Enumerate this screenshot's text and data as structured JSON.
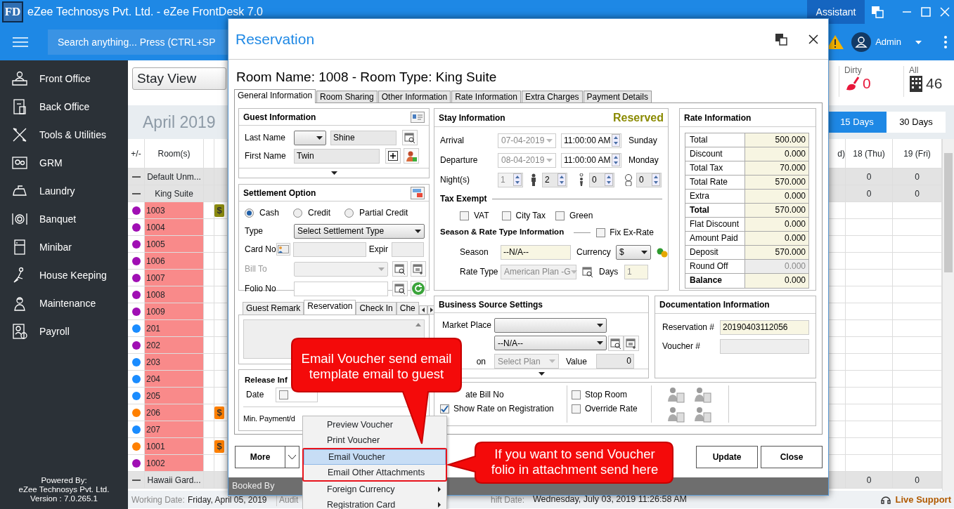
{
  "app": {
    "logo": "FD",
    "title": "eZee Technosys Pvt. Ltd. - eZee FrontDesk 7.0",
    "assistant": "Assistant"
  },
  "toolbar": {
    "search_placeholder": "Search anything... Press (CTRL+SP",
    "user": "Admin"
  },
  "sidebar": {
    "items": [
      {
        "label": "Front Office"
      },
      {
        "label": "Back Office"
      },
      {
        "label": "Tools & Utilities"
      },
      {
        "label": "GRM"
      },
      {
        "label": "Laundry"
      },
      {
        "label": "Banquet"
      },
      {
        "label": "Minibar"
      },
      {
        "label": "House Keeping"
      },
      {
        "label": "Maintenance"
      },
      {
        "label": "Payroll"
      }
    ],
    "footer": [
      "Powered By:",
      "eZee Technosys Pvt. Ltd.",
      "Version : 7.0.265.1"
    ]
  },
  "view": {
    "selector": "Stay View",
    "month": "April 2019",
    "stats": [
      {
        "kind": "dirty",
        "label": "Dirty",
        "value": "0"
      },
      {
        "kind": "all",
        "label": "All",
        "value": "46"
      }
    ],
    "ranges": [
      {
        "label": "15 Days",
        "selected": true
      },
      {
        "label": "30 Days",
        "selected": false
      }
    ]
  },
  "grid": {
    "columns_left": [
      "+/-",
      "Room(s)"
    ],
    "columns_right": [
      "d)",
      "18 (Thu)",
      "19 (Fri)"
    ],
    "rows": [
      {
        "kind": "group",
        "room": "Default Unm...",
        "values": [
          "0",
          "0"
        ]
      },
      {
        "kind": "group",
        "room": "King Suite",
        "values": [
          "0",
          "0"
        ]
      },
      {
        "kind": "room",
        "room": "1003",
        "color": "#a00fb4",
        "badge": {
          "text": "$",
          "color": "#8a8a10"
        }
      },
      {
        "kind": "room",
        "room": "1004",
        "color": "#a00fb4"
      },
      {
        "kind": "room",
        "room": "1005",
        "color": "#a00fb4"
      },
      {
        "kind": "room",
        "room": "1006",
        "color": "#a00fb4"
      },
      {
        "kind": "room",
        "room": "1007",
        "color": "#a00fb4"
      },
      {
        "kind": "room",
        "room": "1008",
        "color": "#a00fb4"
      },
      {
        "kind": "room",
        "room": "1009",
        "color": "#a00fb4"
      },
      {
        "kind": "room",
        "room": "201",
        "color": "#1a8cff"
      },
      {
        "kind": "room",
        "room": "202",
        "color": "#a00fb4"
      },
      {
        "kind": "room",
        "room": "203",
        "color": "#1a8cff"
      },
      {
        "kind": "room",
        "room": "204",
        "color": "#1a8cff"
      },
      {
        "kind": "room",
        "room": "205",
        "color": "#1a8cff"
      },
      {
        "kind": "room",
        "room": "206",
        "color": "#ff8000",
        "badge": {
          "text": "$",
          "color": "#ff8000"
        }
      },
      {
        "kind": "room",
        "room": "207",
        "color": "#1a8cff"
      },
      {
        "kind": "room",
        "room": "1001",
        "color": "#ff8000",
        "badge": {
          "text": "$",
          "color": "#ff8000"
        }
      },
      {
        "kind": "room",
        "room": "1002",
        "color": "#a00fb4"
      },
      {
        "kind": "group",
        "room": "Hawaii Gard...",
        "values": [
          "0",
          "0"
        ]
      }
    ]
  },
  "dialog": {
    "title": "Reservation",
    "heading": "Room Name: 1008 - Room Type: King Suite",
    "tabs": [
      {
        "label": "General Information",
        "selected": true
      },
      {
        "label": "Room Sharing",
        "selected": false
      },
      {
        "label": "Other Information",
        "selected": false
      },
      {
        "label": "Rate Information",
        "selected": false
      },
      {
        "label": "Extra Charges",
        "selected": false
      },
      {
        "label": "Payment Details",
        "selected": false
      }
    ],
    "guest": {
      "title": "Guest Information",
      "last_name": {
        "label": "Last Name",
        "value": "Shine"
      },
      "first_name": {
        "label": "First Name",
        "value": "Twin"
      }
    },
    "settlement": {
      "title": "Settlement Option",
      "modes": [
        {
          "label": "Cash",
          "selected": true
        },
        {
          "label": "Credit",
          "selected": false
        },
        {
          "label": "Partial Credit",
          "selected": false
        }
      ],
      "type": {
        "label": "Type",
        "value": "Select Settlement Type"
      },
      "card_no": {
        "label": "Card No"
      },
      "expiry": {
        "label": "Expir"
      },
      "bill_to": {
        "label": "Bill To",
        "disabled": true
      },
      "folio_no": {
        "label": "Folio No"
      }
    },
    "remark_tabs": [
      {
        "label": "Guest Remark",
        "selected": false
      },
      {
        "label": "Reservation",
        "selected": true
      },
      {
        "label": "Check In",
        "selected": false
      },
      {
        "label": "Che",
        "selected": false
      }
    ],
    "release": {
      "title": "Release Inf",
      "date": {
        "label": "Date",
        "checked": false
      },
      "min_payment": {
        "label": "Min. Payment/d"
      }
    },
    "stay": {
      "title": "Stay Information",
      "status": "Reserved",
      "rows": [
        {
          "label": "Arrival",
          "date": "07-04-2019",
          "time": "11:00:00 AM",
          "day": "Sunday"
        },
        {
          "label": "Departure",
          "date": "08-04-2019",
          "time": "11:00:00 AM",
          "day": "Monday"
        }
      ],
      "nights": {
        "label": "Night(s)",
        "value": "1",
        "disabled": true
      },
      "occupancy": [
        {
          "kind": "adult",
          "value": "2"
        },
        {
          "kind": "child",
          "value": "0"
        },
        {
          "kind": "infant",
          "value": "0"
        }
      ],
      "tax_exempt": {
        "title": "Tax Exempt",
        "options": [
          {
            "label": "VAT",
            "checked": false
          },
          {
            "label": "City Tax",
            "checked": false
          },
          {
            "label": "Green",
            "checked": false
          }
        ]
      },
      "season_title": "Season & Rate Type Information",
      "fix_ex_rate": {
        "label": "Fix Ex-Rate",
        "checked": false
      },
      "season": {
        "label": "Season",
        "value": "--N/A--"
      },
      "currency": {
        "label": "Currency",
        "value": "$"
      },
      "rate_type": {
        "label": "Rate Type",
        "value": "American Plan -G"
      },
      "days": {
        "label": "Days",
        "value": "1",
        "disabled": true
      }
    },
    "rate": {
      "title": "Rate Information",
      "rows": [
        {
          "label": "Total",
          "value": "500.000",
          "bold": false,
          "disabled": false
        },
        {
          "label": "Discount",
          "value": "0.000",
          "bold": false,
          "disabled": false
        },
        {
          "label": "Total Tax",
          "value": "70.000",
          "bold": false,
          "disabled": false
        },
        {
          "label": "Total Rate",
          "value": "570.000",
          "bold": false,
          "disabled": false
        },
        {
          "label": "Extra",
          "value": "0.000",
          "bold": false,
          "disabled": false
        },
        {
          "label": "Total",
          "value": "570.000",
          "bold": true,
          "disabled": false
        },
        {
          "label": "Flat Discount",
          "value": "0.000",
          "bold": false,
          "disabled": false
        },
        {
          "label": "Amount Paid",
          "value": "0.000",
          "bold": false,
          "disabled": false
        },
        {
          "label": "Deposit",
          "value": "570.000",
          "bold": false,
          "disabled": false
        },
        {
          "label": "Round Off",
          "value": "0.000",
          "bold": false,
          "disabled": true
        },
        {
          "label": "Balance",
          "value": "0.000",
          "bold": true,
          "disabled": false
        }
      ]
    },
    "business": {
      "title": "Business Source Settings",
      "market_place": {
        "label": "Market Place"
      },
      "source": {
        "value": "--N/A--"
      },
      "plan": {
        "label": "on",
        "value": "Select Plan"
      },
      "amount": {
        "label": "Value",
        "value": "0"
      }
    },
    "documentation": {
      "title": "Documentation Information",
      "rows": [
        {
          "label": "Reservation #",
          "value": "20190403112056"
        },
        {
          "label": "Voucher #"
        }
      ]
    },
    "options": [
      [
        {
          "kind": "text",
          "label": "ate Bill No"
        },
        {
          "kind": "checkbox",
          "label": "Show Rate on Registration",
          "checked": true
        }
      ],
      [
        {
          "kind": "checkbox",
          "label": "Stop Room",
          "checked": false
        },
        {
          "kind": "checkbox",
          "label": "Override Rate",
          "checked": false
        }
      ]
    ],
    "footer": {
      "more": "More",
      "buttons": [
        "Update",
        "Close"
      ],
      "booked_by": "Booked By"
    }
  },
  "menu": {
    "items": [
      {
        "label": "Preview Voucher",
        "selected": false,
        "submenu": false
      },
      {
        "label": "Print Voucher",
        "selected": false,
        "submenu": false
      },
      {
        "label": "Email Voucher",
        "selected": true,
        "submenu": false
      },
      {
        "label": "Email Other Attachments",
        "selected": false,
        "submenu": false
      },
      {
        "label": "Foreign Currency",
        "selected": false,
        "submenu": true
      },
      {
        "label": "Registration Card",
        "selected": false,
        "submenu": true
      }
    ]
  },
  "callouts": [
    {
      "text": "Email Voucher send email template email to guest"
    },
    {
      "text": "If you want to send Voucher folio in attachment send here"
    }
  ],
  "status_bar": {
    "items": [
      {
        "label": "Working Date:",
        "value": "Friday, April 05, 2019"
      },
      {
        "label": "Audit"
      },
      {
        "label": "hift Date:",
        "value": "Wednesday, July 03, 2019 11:26:58 AM"
      }
    ],
    "live_support": "Live Support"
  }
}
